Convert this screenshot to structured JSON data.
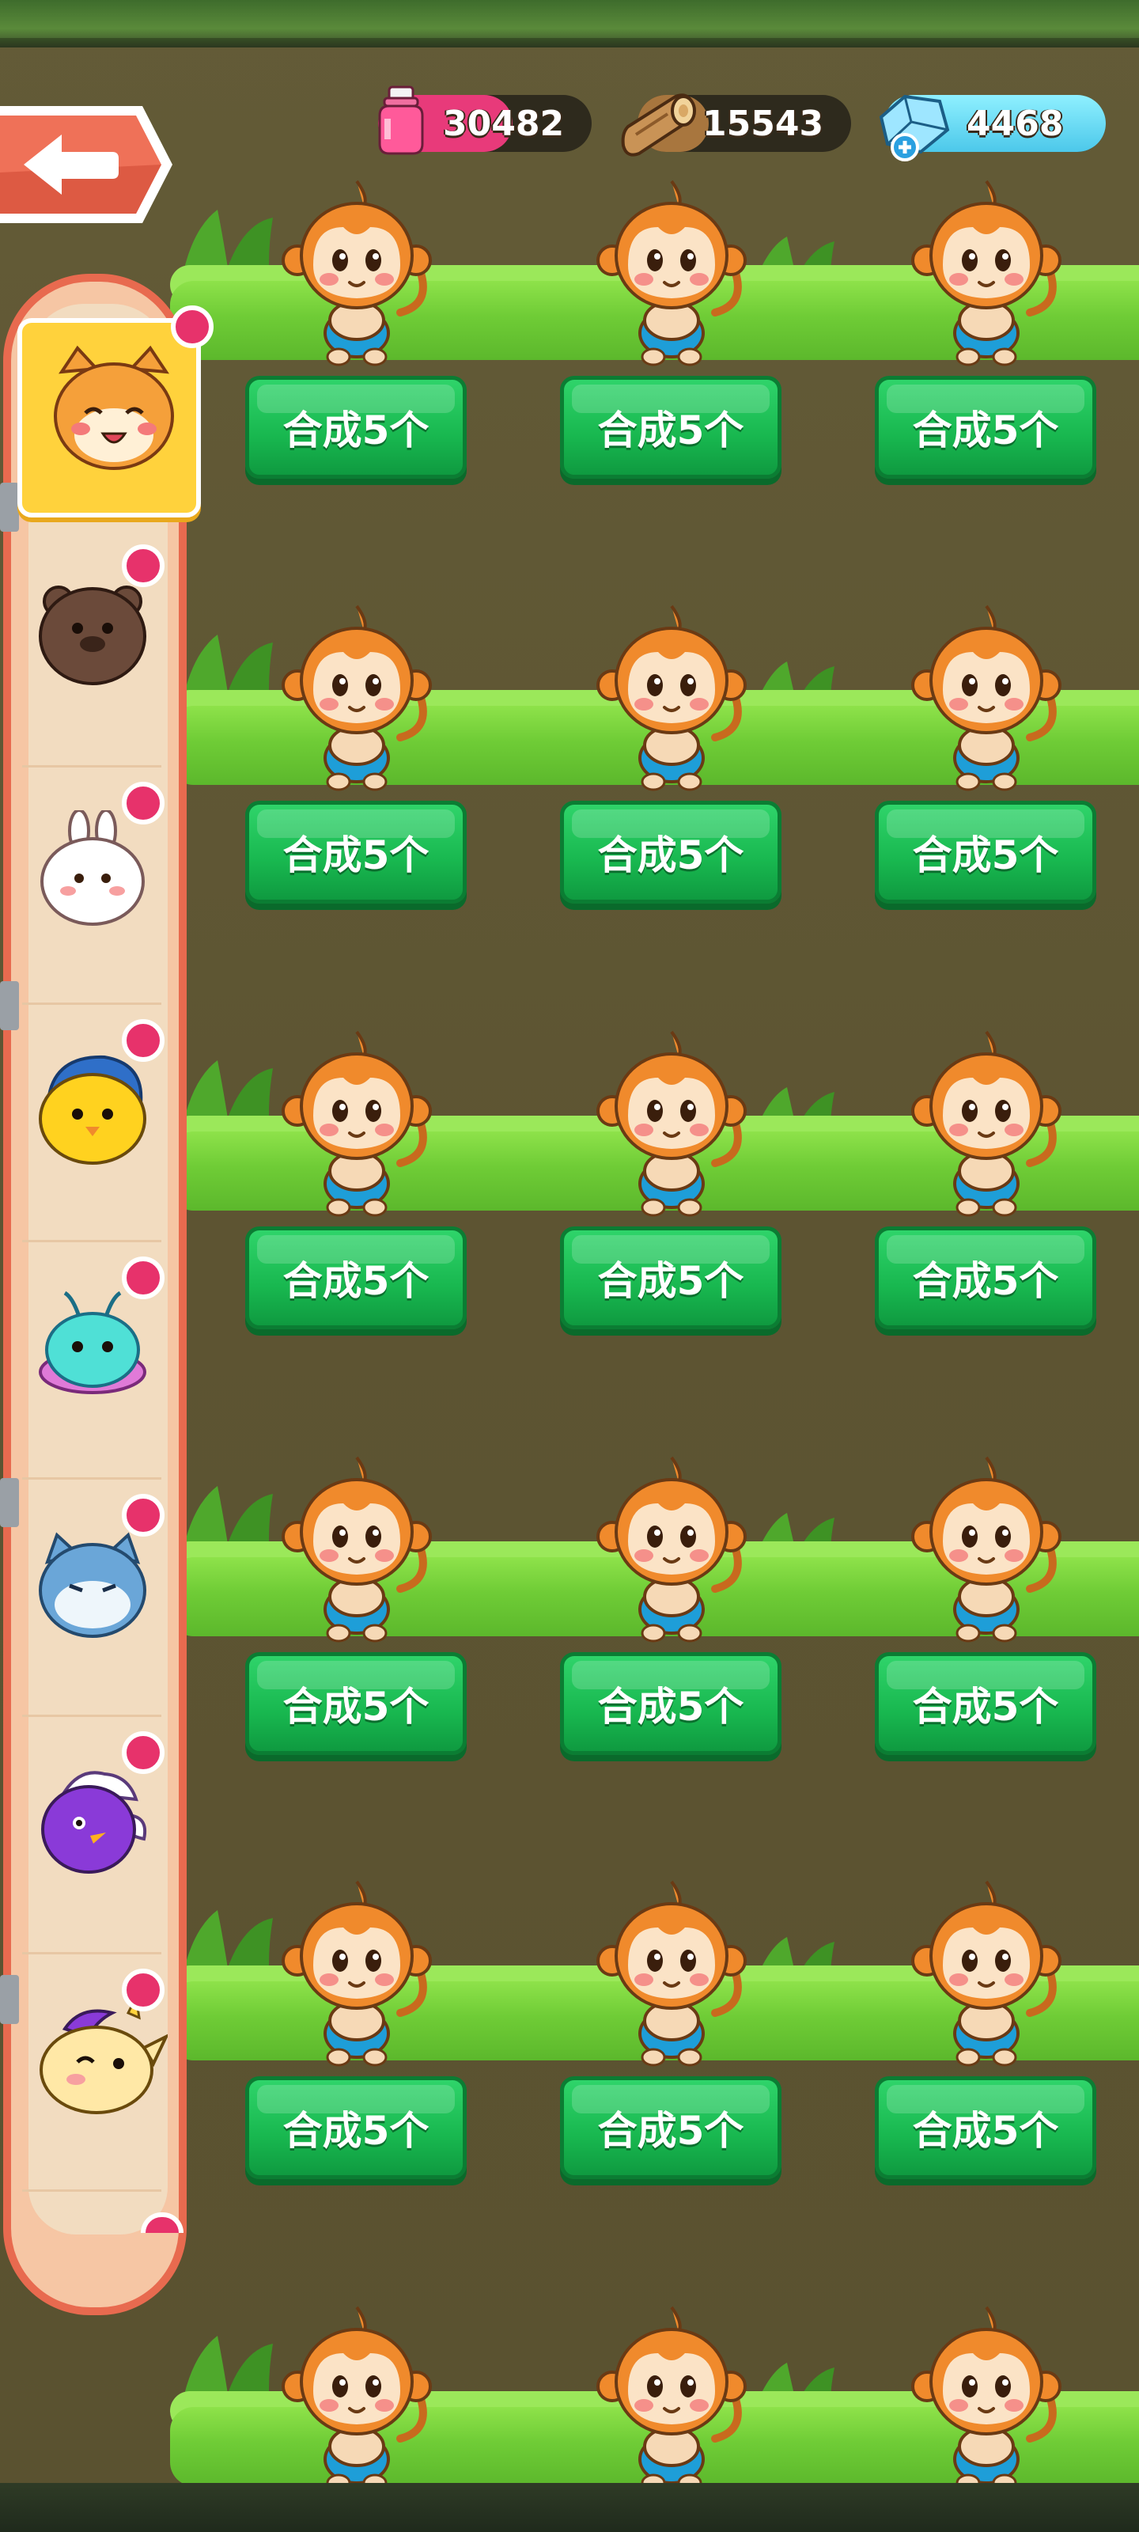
{
  "resources": {
    "potion": {
      "icon": "pink-potion-icon",
      "value": "30482",
      "color": "#e83a7a"
    },
    "wood": {
      "icon": "wood-log-icon",
      "value": "15543",
      "color": "#b8834a"
    },
    "gems": {
      "icon": "blue-gem-icon",
      "value": "4468",
      "color": "#5fd8f0"
    }
  },
  "back_button": {
    "icon": "back-arrow-icon"
  },
  "sidebar": {
    "tabs": [
      {
        "name": "orange-cat",
        "icon": "orange-cat-icon",
        "selected": true
      },
      {
        "name": "brown-bear",
        "icon": "brown-bear-icon",
        "selected": false
      },
      {
        "name": "white-rabbit",
        "icon": "white-rabbit-icon",
        "selected": false
      },
      {
        "name": "yellow-chick",
        "icon": "yellow-chick-icon",
        "selected": false
      },
      {
        "name": "teal-alien",
        "icon": "teal-alien-icon",
        "selected": false
      },
      {
        "name": "blue-cat",
        "icon": "blue-cat-icon",
        "selected": false
      },
      {
        "name": "purple-bird",
        "icon": "purple-bird-icon",
        "selected": false
      },
      {
        "name": "unicorn",
        "icon": "unicorn-icon",
        "selected": false
      }
    ]
  },
  "grid": {
    "character": "monkey",
    "merge_label": "合成5个",
    "rows": 6,
    "cols": 3
  },
  "colors": {
    "merge_button": "#1fbf55",
    "grass": "#7ad63e",
    "background": "#5d5432",
    "sidebar_border": "#e86a4f",
    "badge": "#e7326b"
  }
}
